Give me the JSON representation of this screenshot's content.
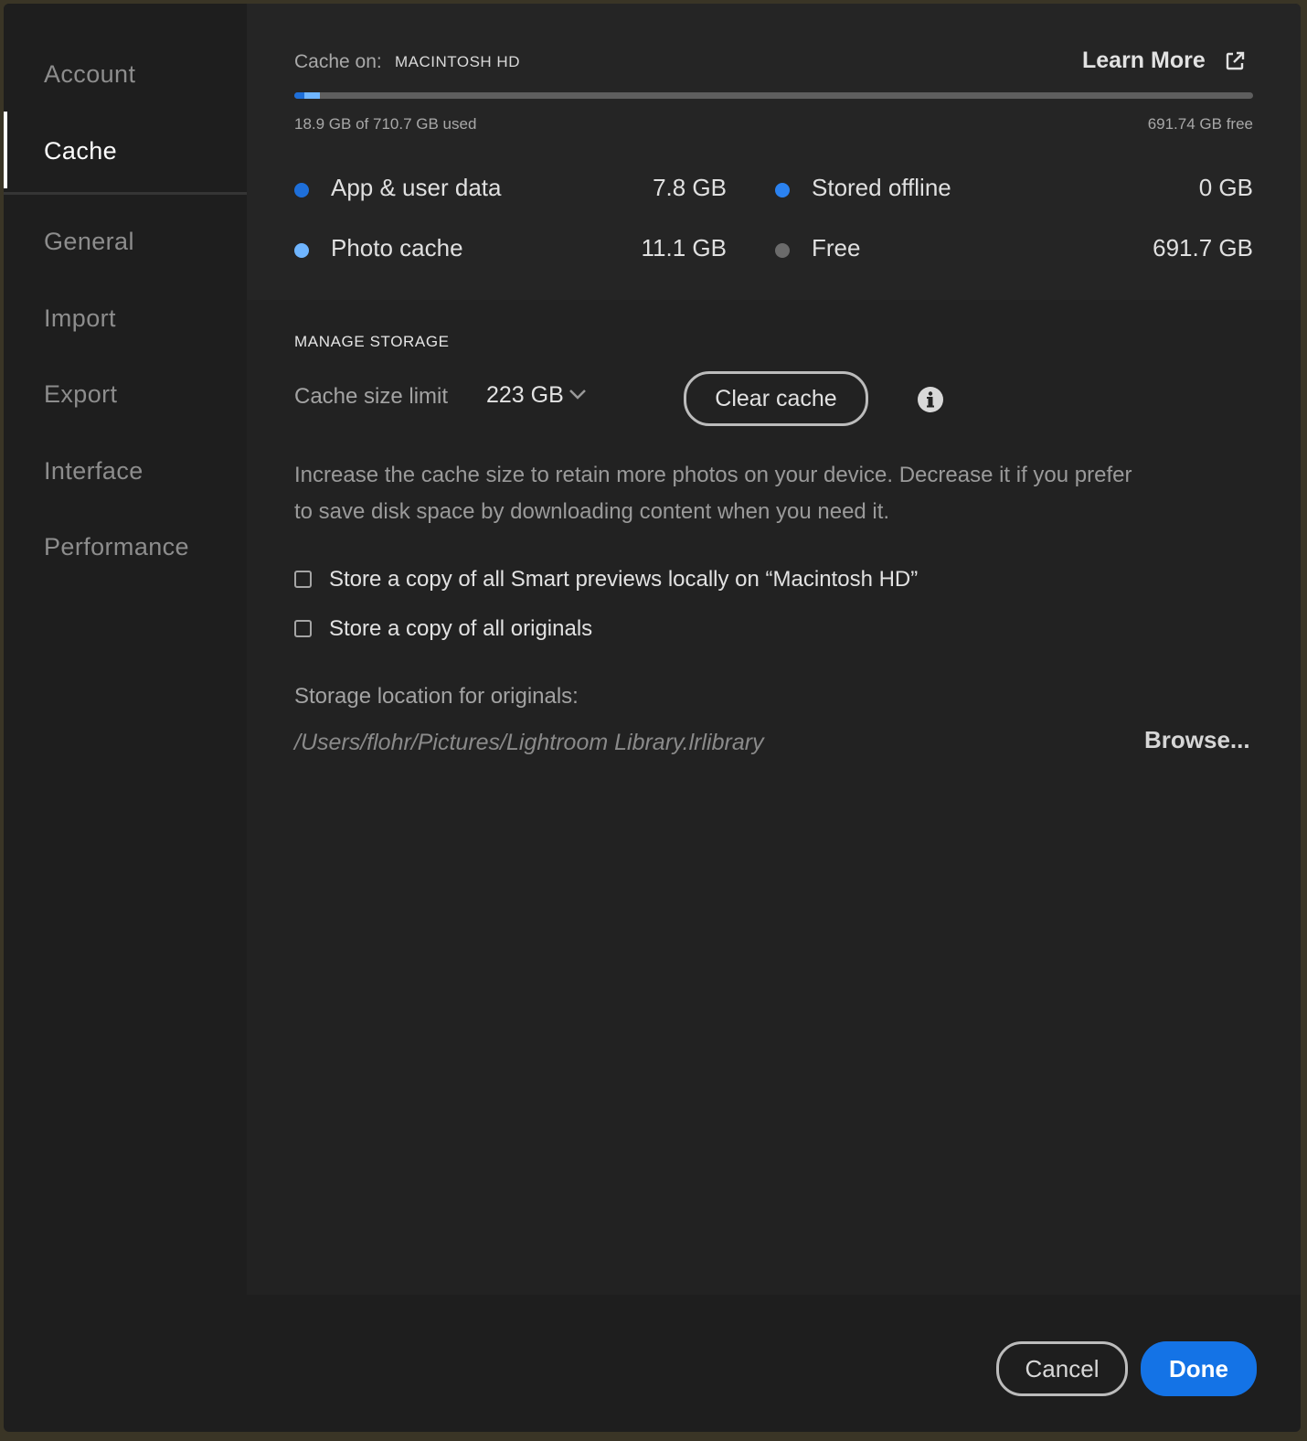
{
  "sidebar": {
    "items": [
      {
        "label": "Account"
      },
      {
        "label": "Cache"
      },
      {
        "label": "General"
      },
      {
        "label": "Import"
      },
      {
        "label": "Export"
      },
      {
        "label": "Interface"
      },
      {
        "label": "Performance"
      }
    ],
    "active": "Cache"
  },
  "storage": {
    "cache_on_label": "Cache on:",
    "drive_name": "MACINTOSH HD",
    "learn_more": "Learn More",
    "learn_more_icon": "external-link-icon",
    "used_text": "18.9 GB of 710.7 GB used",
    "free_text": "691.74 GB free",
    "usage_fraction": 0.0266,
    "legend": [
      {
        "label": "App & user data",
        "value": "7.8 GB",
        "color": "#1e6fd9"
      },
      {
        "label": "Photo cache",
        "value": "11.1 GB",
        "color": "#6fb5ff"
      },
      {
        "label": "Stored offline",
        "value": "0 GB",
        "color": "#2b82f0"
      },
      {
        "label": "Free",
        "value": "691.7 GB",
        "color": "#6b6b6b"
      }
    ]
  },
  "manage": {
    "title": "MANAGE STORAGE",
    "limit_label": "Cache size limit",
    "limit_value": "223 GB",
    "clear_button": "Clear cache",
    "info_icon": "info-icon",
    "description": "Increase the cache size to retain more photos on your device. Decrease it if you prefer to save disk space by downloading content when you need it.",
    "checkboxes": [
      {
        "label": "Store a copy of all Smart previews locally on “Macintosh HD”",
        "checked": false
      },
      {
        "label": "Store a copy of all originals",
        "checked": false
      }
    ],
    "location_label": "Storage location for originals:",
    "location_path": "/Users/flohr/Pictures/Lightroom Library.lrlibrary",
    "browse_button": "Browse..."
  },
  "footer": {
    "cancel": "Cancel",
    "done": "Done"
  },
  "colors": {
    "accent": "#1473e6",
    "background": "#1e1e1e"
  }
}
